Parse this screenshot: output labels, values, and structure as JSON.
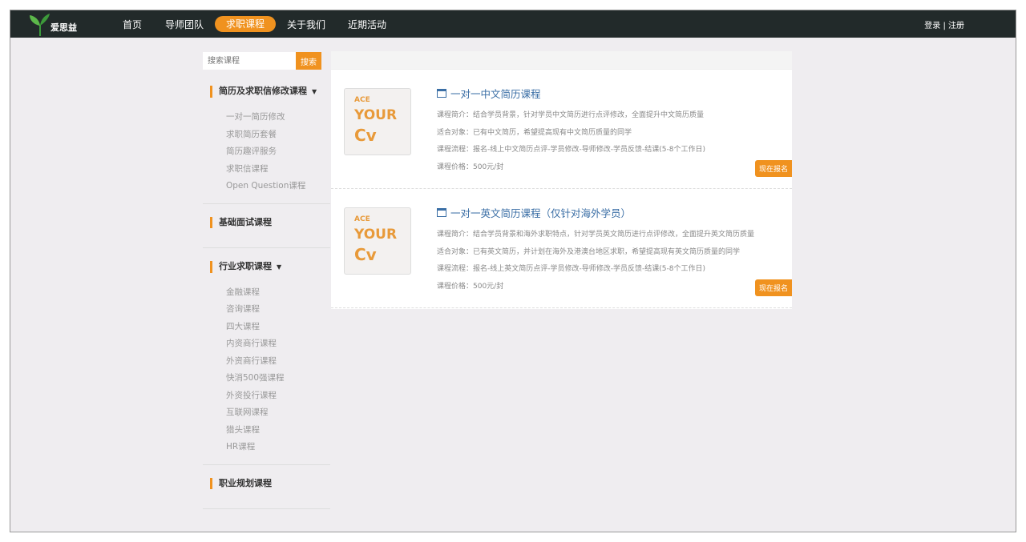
{
  "nav": {
    "logo_text": "爱思益",
    "items": [
      "首页",
      "导师团队",
      "求职课程",
      "关于我们",
      "近期活动"
    ],
    "active": 2,
    "auth": "登录 | 注册"
  },
  "search": {
    "placeholder": "搜索课程",
    "button": "搜索"
  },
  "sidebar": [
    {
      "title": "简历及求职信修改课程",
      "expandable": true,
      "items": [
        "一对一简历修改",
        "求职简历套餐",
        "简历趣评服务",
        "求职信课程",
        "Open Question课程"
      ]
    },
    {
      "title": "基础面试课程",
      "expandable": false,
      "items": []
    },
    {
      "title": "行业求职课程",
      "expandable": true,
      "items": [
        "金融课程",
        "咨询课程",
        "四大课程",
        "内资商行课程",
        "外资商行课程",
        "快消500强课程",
        "外资投行课程",
        "互联网课程",
        "猎头课程",
        "HR课程"
      ]
    },
    {
      "title": "职业规划课程",
      "expandable": false,
      "items": []
    }
  ],
  "courses": [
    {
      "thumb": [
        "ACE",
        "YOUR",
        "Cv"
      ],
      "title": "一对一中文简历课程",
      "lines": [
        "课程简介：结合学员背景，针对学员中文简历进行点评修改，全面提升中文简历质量",
        "适合对象：已有中文简历，希望提高现有中文简历质量的同学",
        "课程流程：报名-线上中文简历点评-学员修改-导师修改-学员反馈-结课(5-8个工作日)",
        "课程价格：500元/封"
      ],
      "button": "现在报名"
    },
    {
      "thumb": [
        "ACE",
        "YOUR",
        "Cv"
      ],
      "title": "一对一英文简历课程（仅针对海外学员）",
      "lines": [
        "课程简介：结合学员背景和海外求职特点，针对学员英文简历进行点评修改，全面提升英文简历质量",
        "适合对象：已有英文简历，并计划在海外及港澳台地区求职，希望提高现有英文简历质量的同学",
        "课程流程：报名-线上英文简历点评-学员修改-导师修改-学员反馈-结课(5-8个工作日)",
        "课程价格：500元/封"
      ],
      "button": "现在报名"
    }
  ],
  "colors": {
    "accent": "#f0921f",
    "nav_bg": "#222a2a",
    "link": "#3a6ea5"
  }
}
